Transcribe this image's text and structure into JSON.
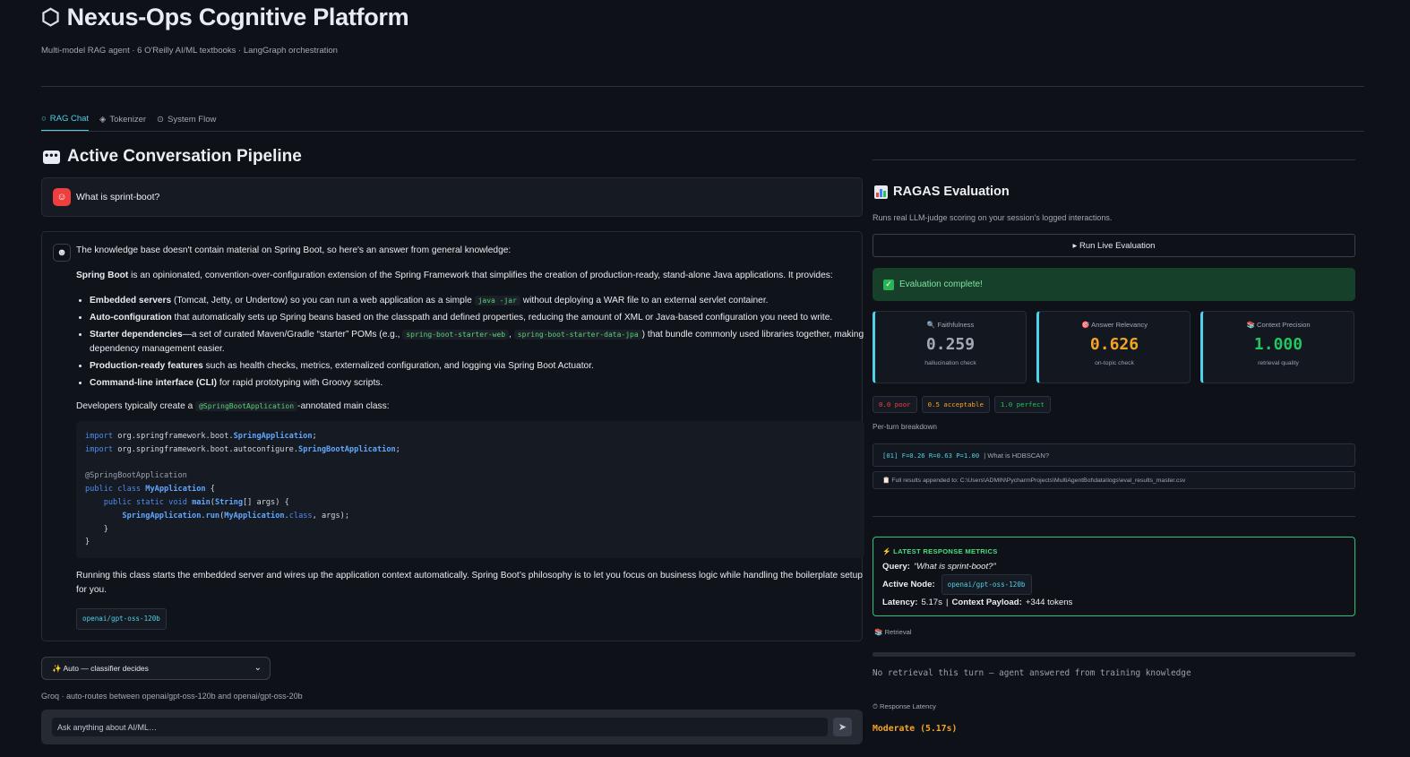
{
  "header": {
    "icon": "hexagon-icon",
    "title": "Nexus-Ops Cognitive Platform",
    "subtitle": "Multi-model RAG agent · 6 O'Reilly AI/ML textbooks · LangGraph orchestration"
  },
  "tabs": [
    {
      "icon": "○",
      "label": "RAG Chat"
    },
    {
      "icon": "◈",
      "label": "Tokenizer"
    },
    {
      "icon": "⊙",
      "label": "System Flow"
    }
  ],
  "chat": {
    "heading": "Active Conversation Pipeline",
    "user_message": "What is sprint-boot?",
    "bot": {
      "intro": "The knowledge base doesn't contain material on Spring Boot, so here's an answer from general knowledge:",
      "def_bold": "Spring Boot",
      "def_rest": " is an opinionated, convention-over-configuration extension of the Spring Framework that simplifies the creation of production-ready, stand-alone Java applications. It provides:",
      "bullets": [
        {
          "bold": "Embedded servers",
          "pre": " (Tomcat, Jetty, or Undertow) so you can run a web application as a simple ",
          "code": "java -jar",
          "post": " without deploying a WAR file to an external servlet container."
        },
        {
          "bold": "Auto-configuration",
          "pre": " that automatically sets up Spring beans based on the classpath and defined properties, reducing the amount of XML or Java-based configuration you need to write."
        },
        {
          "bold": "Starter dependencies",
          "pre": "—a set of curated Maven/Gradle “starter” POMs (e.g., ",
          "code": "spring-boot-starter-web",
          "mid": ", ",
          "code2": "spring-boot-starter-data-jpa",
          "post": ") that bundle commonly used libraries together, making dependency management easier."
        },
        {
          "bold": "Production-ready features",
          "pre": " such as health checks, metrics, externalized configuration, and logging via Spring Boot Actuator."
        },
        {
          "bold": "Command-line interface (CLI)",
          "pre": " for rapid prototyping with Groovy scripts."
        }
      ],
      "dev_pre": "Developers typically create a ",
      "dev_code": "@SpringBootApplication",
      "dev_post": "-annotated main class:",
      "code_lines": [
        "import org.springframework.boot.SpringApplication;",
        "import org.springframework.boot.autoconfigure.SpringBootApplication;",
        "",
        "@SpringBootApplication",
        "public class MyApplication {",
        "    public static void main(String[] args) {",
        "        SpringApplication.run(MyApplication.class, args);",
        "    }",
        "}"
      ],
      "closing": "Running this class starts the embedded server and wires up the application context automatically. Spring Boot’s philosophy is to let you focus on business logic while handling the boilerplate setup for you.",
      "model_tag": "openai/gpt-oss-120b"
    }
  },
  "model_select": {
    "selected": "✨ Auto — classifier decides",
    "note": "Groq · auto-routes between openai/gpt-oss-120b and openai/gpt-oss-20b"
  },
  "chat_input": {
    "placeholder": "Ask anything about AI/ML…"
  },
  "ragas": {
    "heading": "RAGAS Evaluation",
    "subtitle": "Runs real LLM-judge scoring on your session's logged interactions.",
    "run_button": "▸ Run Live Evaluation",
    "success": "Evaluation complete!",
    "metrics": [
      {
        "icon": "🔍",
        "label": "Faithfulness",
        "value": "0.259",
        "caption": "hallucination check",
        "color": "#a3a8b4"
      },
      {
        "icon": "🎯",
        "label": "Answer Relevancy",
        "value": "0.626",
        "caption": "on-topic check",
        "color": "#f5a524"
      },
      {
        "icon": "📚",
        "label": "Context Precision",
        "value": "1.000",
        "caption": "retrieval quality",
        "color": "#22c55e"
      }
    ],
    "legend": [
      {
        "label": "0.0 poor",
        "color": "#ef4444"
      },
      {
        "label": "0.5 acceptable",
        "color": "#f5a524"
      },
      {
        "label": "1.0 perfect",
        "color": "#22c55e"
      }
    ],
    "per_turn_label": "Per-turn breakdown",
    "turn": {
      "scores": "[01] F=0.26 R=0.63 P=1.00",
      "query": "| What is HDBSCAN?"
    },
    "results_path": "📋 Full results appended to: C:\\Users\\ADMIN\\PycharmProjects\\MultiAgentBot\\data\\logs\\eval_results_master.csv"
  },
  "latest": {
    "heading": "⚡ LATEST RESPONSE METRICS",
    "query_label": "Query:",
    "query": "“What is sprint-boot?”",
    "node_label": "Active Node:",
    "node": "openai/gpt-oss-120b",
    "latency_label": "Latency:",
    "latency": "5.17s",
    "payload_label": "Context Payload:",
    "payload": "+344 tokens"
  },
  "retrieval": {
    "label": "📚 Retrieval",
    "text": "No retrieval this turn — agent answered from training knowledge"
  },
  "response_latency": {
    "label": "⏱ Response Latency",
    "value": "Moderate (5.17s)"
  }
}
